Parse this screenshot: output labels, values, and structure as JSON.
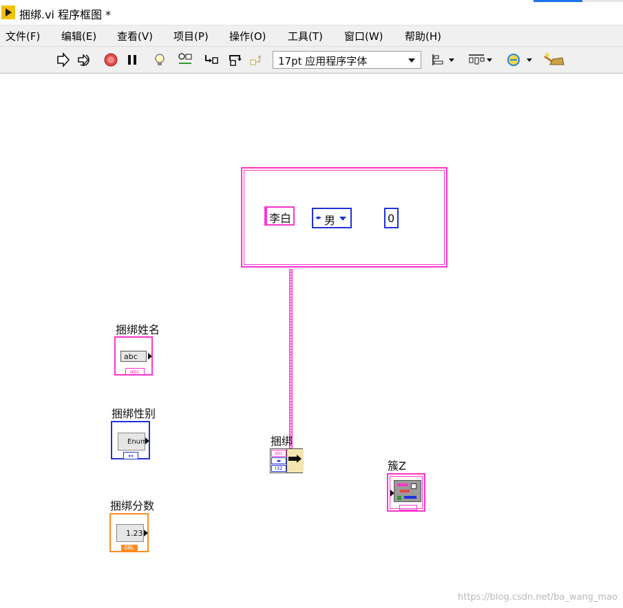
{
  "window": {
    "title": "捆绑.vi 程序框图 *"
  },
  "menu": {
    "items": [
      {
        "label": "文件(F)"
      },
      {
        "label": "编辑(E)"
      },
      {
        "label": "查看(V)"
      },
      {
        "label": "项目(P)"
      },
      {
        "label": "操作(O)"
      },
      {
        "label": "工具(T)"
      },
      {
        "label": "窗口(W)"
      },
      {
        "label": "帮助(H)"
      }
    ]
  },
  "toolbar": {
    "font_value": "17pt 应用程序字体",
    "icons": [
      "run-icon",
      "run-continuously-icon",
      "abort-icon",
      "pause-icon",
      "highlight-execution-icon",
      "retain-wire-values-icon",
      "step-into-icon",
      "step-over-icon",
      "step-out-icon",
      "align-objects-icon",
      "distribute-objects-icon",
      "reorder-icon",
      "clean-up-diagram-icon"
    ],
    "colors": {
      "run_arrow": "#111111",
      "abort": "#e04a4a",
      "bulb": "#f2d94e",
      "green": "#2e9a2e"
    }
  },
  "diagram": {
    "cluster_constant": {
      "name_value": "李白",
      "gender_value": "男",
      "score_value": "0"
    },
    "terminals": {
      "name": {
        "label": "捆绑姓名",
        "inner_text": "abc",
        "type_tag": "abc",
        "color": "#ff33cc"
      },
      "gender": {
        "label": "捆绑性别",
        "inner_text": "Enum",
        "type_tag": "◂▸",
        "color": "#2030e0"
      },
      "score": {
        "label": "捆绑分数",
        "inner_text": "1.23",
        "type_tag": "DBL",
        "color": "#ff8a1f"
      },
      "cluster": {
        "label": "簇Z",
        "color": "#ff33cc"
      }
    },
    "bundle_node": {
      "label": "捆绑",
      "inputs": [
        "abc",
        "◂▸",
        "I32"
      ]
    }
  },
  "watermark": "https://blog.csdn.net/ba_wang_mao"
}
